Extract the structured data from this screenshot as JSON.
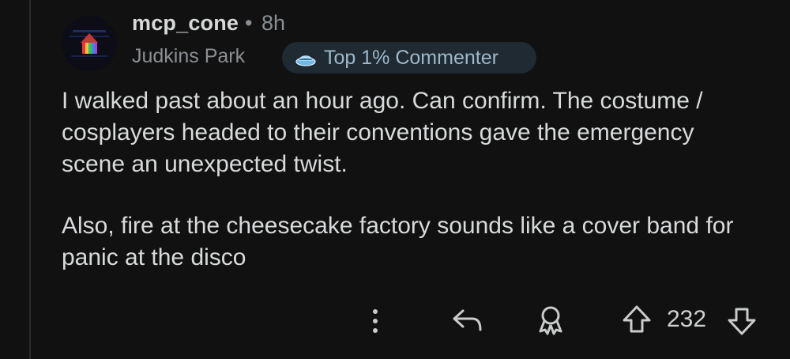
{
  "comment": {
    "author": "mcp_cone",
    "separator": "•",
    "time": "8h",
    "flair": "Judkins Park",
    "badge": {
      "icon": "commenter-hat-icon",
      "label": "Top 1% Commenter",
      "color": "#9fb8c9"
    },
    "paragraphs": [
      "I walked past about an hour ago. Can confirm. The costume / cosplayers headed to their conventions gave the emergency scene an unexpected twist.",
      "Also, fire at the cheesecake factory sounds like a cover band for panic at the disco"
    ]
  },
  "actions": {
    "more_icon": "vertical-ellipsis-icon",
    "reply_icon": "reply-arrow-icon",
    "award_icon": "award-icon",
    "upvote_icon": "upvote-arrow-icon",
    "score": "232",
    "downvote_icon": "downvote-arrow-icon"
  },
  "colors": {
    "background": "#111111",
    "text": "#d8dadb",
    "muted": "#8b8f93",
    "badge_bg": "#1f2a33"
  }
}
